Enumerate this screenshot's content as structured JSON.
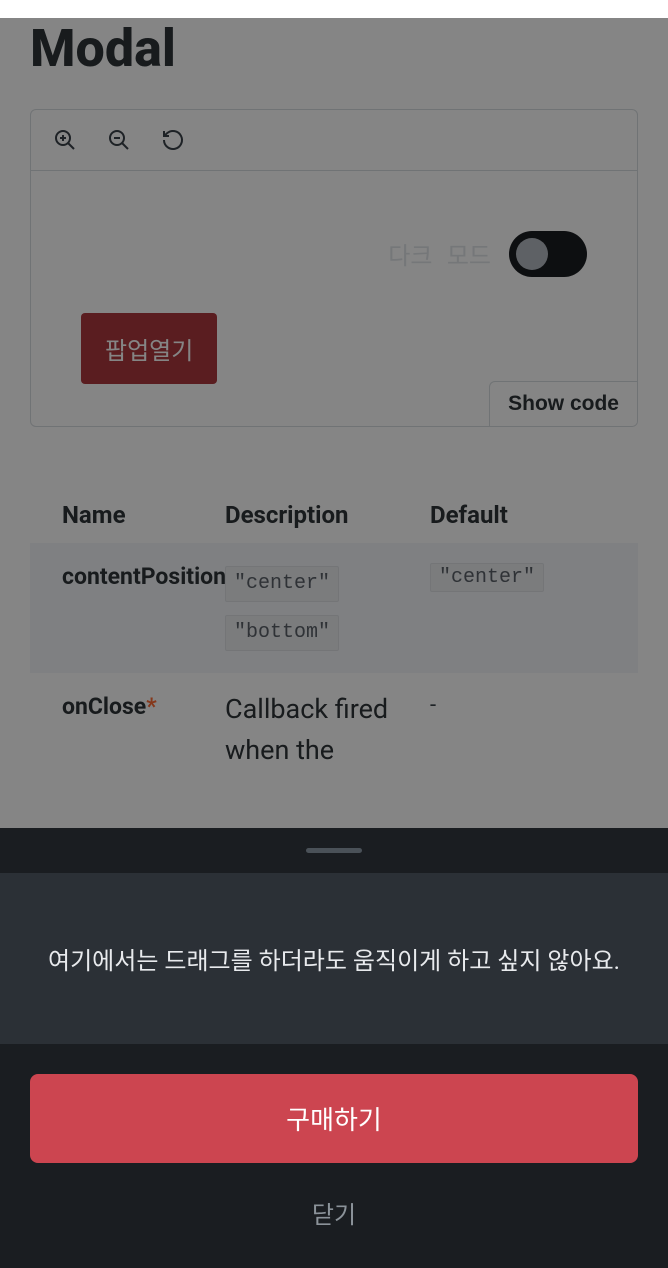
{
  "page": {
    "title": "Modal"
  },
  "preview": {
    "dark_mode_label": "다크 모드",
    "popup_button": "팝업열기",
    "show_code": "Show code"
  },
  "table": {
    "headers": {
      "name": "Name",
      "description": "Description",
      "default": "Default"
    },
    "rows": [
      {
        "name": "contentPosition",
        "description_tags": [
          "\"center\"",
          "\"bottom\""
        ],
        "default_tag": "\"center\"",
        "required": false,
        "highlighted": true
      },
      {
        "name": "onClose",
        "description": "Callback fired when the",
        "default": "-",
        "required": true,
        "highlighted": false
      }
    ]
  },
  "modal": {
    "message": "여기에서는 드래그를 하더라도 움직이게 하고 싶지 않아요.",
    "primary_action": "구매하기",
    "secondary_action": "닫기"
  }
}
